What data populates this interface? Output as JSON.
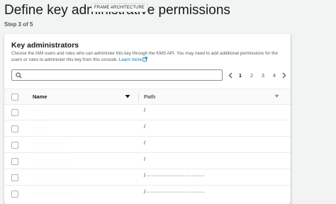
{
  "page": {
    "title": "Define key administrative permissions",
    "frame_label": "FRAME ARCHITECTURE",
    "step": "Step 3 of 5"
  },
  "panel": {
    "title": "Key administrators",
    "description": "Choose the IAM users and roles who can administer this key through the KMS API. You may need to add additional permissions for the users or roles to administer this key from this console.",
    "learn_more": "Learn more"
  },
  "search": {
    "value": "",
    "placeholder": ""
  },
  "pagination": {
    "prev_icon": "chevron-left-icon",
    "pages": [
      "1",
      "2",
      "3",
      "4"
    ],
    "current": "1",
    "next_icon": "chevron-right-icon"
  },
  "table": {
    "columns": [
      "Name",
      "Path"
    ],
    "rows": [
      {
        "name": "··········",
        "path": "/"
      },
      {
        "name": "··········",
        "path": "/"
      },
      {
        "name": "··························",
        "path": "/"
      },
      {
        "name": "··························",
        "path": "/"
      },
      {
        "name": "································",
        "path": "/····································"
      },
      {
        "name": "································",
        "path": "/····································"
      }
    ]
  },
  "colors": {
    "link": "#0073bb",
    "background": "#f2f3f3"
  }
}
